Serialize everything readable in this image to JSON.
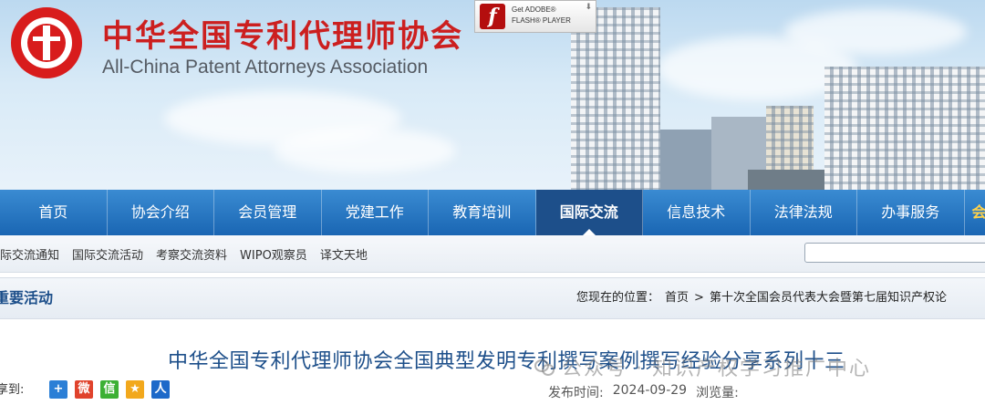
{
  "header": {
    "title_cn": "中华全国专利代理师协会",
    "title_en": "All-China Patent Attorneys Association",
    "flash_badge": {
      "line1": "Get ADOBE®",
      "line2": "FLASH® PLAYER",
      "icon": "flash-icon"
    }
  },
  "nav": {
    "items": [
      {
        "label": "首页"
      },
      {
        "label": "协会介绍"
      },
      {
        "label": "会员管理"
      },
      {
        "label": "党建工作"
      },
      {
        "label": "教育培训"
      },
      {
        "label": "国际交流",
        "active": true
      },
      {
        "label": "信息技术"
      },
      {
        "label": "法律法规"
      },
      {
        "label": "办事服务"
      },
      {
        "label": "会长"
      }
    ]
  },
  "subnav": {
    "links": [
      {
        "label": "际交流通知"
      },
      {
        "label": "国际交流活动"
      },
      {
        "label": "考察交流资料"
      },
      {
        "label": "WIPO观察员"
      },
      {
        "label": "译文天地"
      }
    ],
    "search_placeholder": ""
  },
  "section": {
    "title": "重要活动",
    "breadcrumb": [
      "您现在的位置：",
      "首页",
      ">",
      "第十次全国会员代表大会暨第七届知识产权论"
    ]
  },
  "article": {
    "title": "中华全国专利代理师协会全国典型发明专利撰写案例撰写经验分享系列十三",
    "share_label": "享到:",
    "share_icons": [
      {
        "name": "plus-share-icon",
        "glyph": "+",
        "color": "#2b7fd6"
      },
      {
        "name": "weibo-share-icon",
        "glyph": "微",
        "color": "#e0432c"
      },
      {
        "name": "wechat-share-icon",
        "glyph": "信",
        "color": "#3cb034"
      },
      {
        "name": "qzone-share-icon",
        "glyph": "★",
        "color": "#f2a81c"
      },
      {
        "name": "renren-share-icon",
        "glyph": "人",
        "color": "#1d69c9"
      }
    ],
    "publish_label": "发布时间:",
    "publish_date": "2024-09-29",
    "views_label": "浏览量:"
  },
  "watermark": {
    "text": "公众号 · 知识产权学习推广中心"
  }
}
